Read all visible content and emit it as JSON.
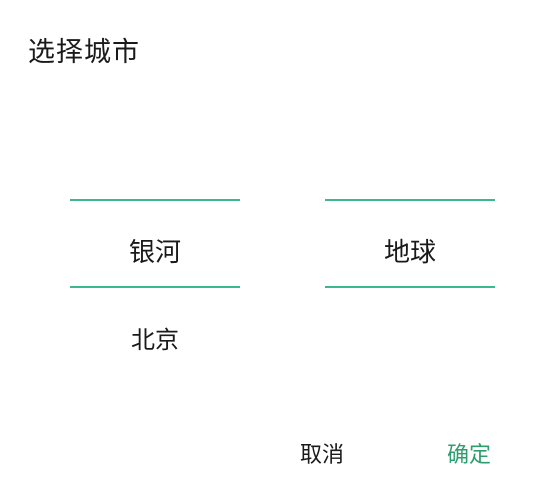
{
  "dialog": {
    "title": "选择城市",
    "accent_color": "#3cb88f",
    "confirm_color": "#2e9e6e"
  },
  "picker_left": {
    "selected": "银河",
    "items_below": [
      "北京"
    ]
  },
  "picker_right": {
    "selected": "地球",
    "items_below": []
  },
  "buttons": {
    "cancel_label": "取消",
    "confirm_label": "确定"
  }
}
